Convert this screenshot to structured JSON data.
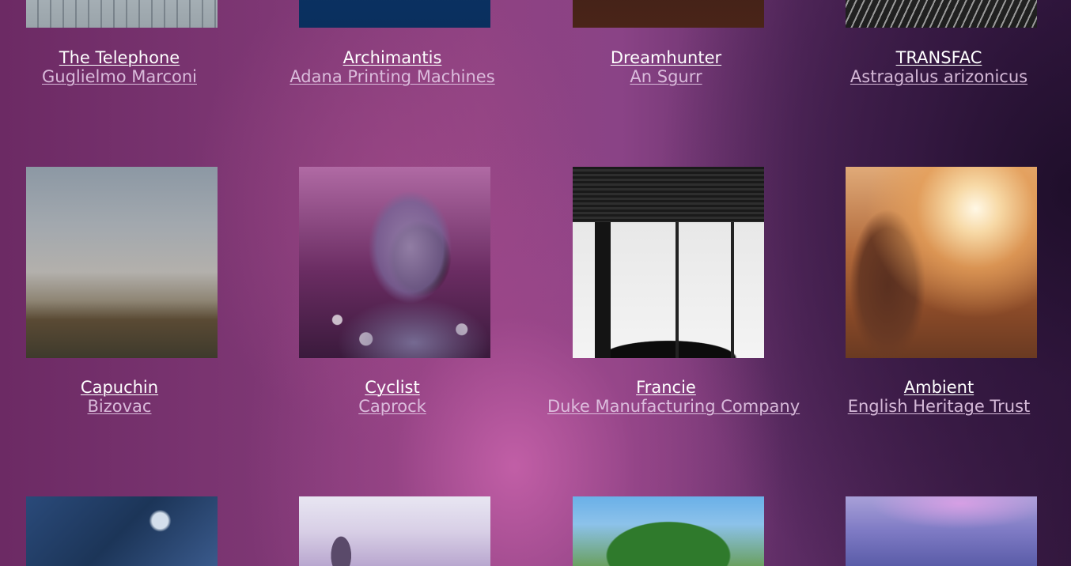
{
  "items": [
    {
      "title": "The Telephone",
      "subtitle": "Guglielmo Marconi",
      "image": "city-window-photo"
    },
    {
      "title": "Archimantis",
      "subtitle": "Adana Printing Machines",
      "image": "deep-blue-water-photo"
    },
    {
      "title": "Dreamhunter",
      "subtitle": "An Sgurr",
      "image": "city-lights-photo"
    },
    {
      "title": "TRANSFAC",
      "subtitle": "Astragalus arizonicus",
      "image": "monochrome-wires-photo"
    },
    {
      "title": "Capuchin",
      "subtitle": "Bizovac",
      "image": "foggy-field-photo"
    },
    {
      "title": "Cyclist",
      "subtitle": "Caprock",
      "image": "hooded-person-daisies-photo"
    },
    {
      "title": "Francie",
      "subtitle": "Duke Manufacturing Company",
      "image": "restaurant-window-silhouettes-photo"
    },
    {
      "title": "Ambient",
      "subtitle": "English Heritage Trust",
      "image": "sunset-woman-photo"
    },
    {
      "title": "",
      "subtitle": "",
      "image": "underwater-rocks-photo"
    },
    {
      "title": "",
      "subtitle": "",
      "image": "jumping-person-sky-photo"
    },
    {
      "title": "",
      "subtitle": "",
      "image": "goats-in-tree-photo"
    },
    {
      "title": "",
      "subtitle": "",
      "image": "purple-haze-field-photo"
    }
  ]
}
